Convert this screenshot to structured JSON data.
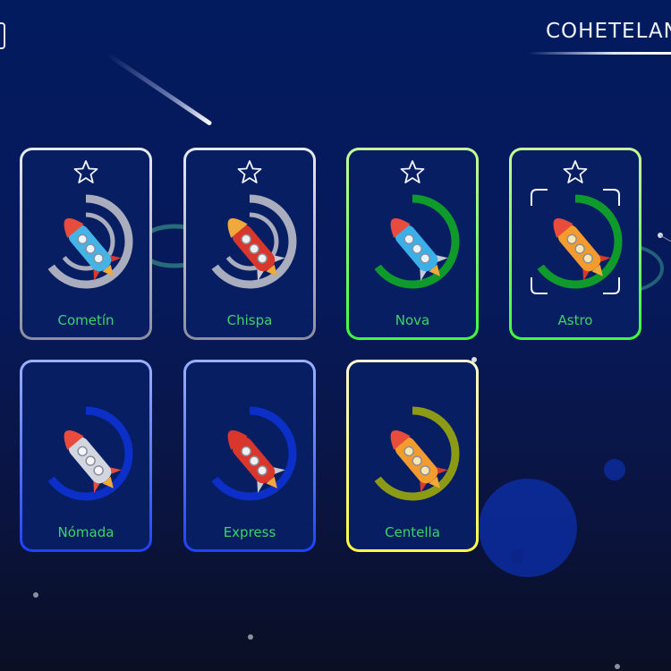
{
  "app": {
    "title": "COHETELAN"
  },
  "rockets": [
    {
      "name": "Cometín",
      "starred": true,
      "frame": "silver",
      "ring": "gray",
      "ring_progress": 0.65,
      "rocket_style": "round-blue",
      "selected": false
    },
    {
      "name": "Chispa",
      "starred": true,
      "frame": "silver",
      "ring": "gray",
      "ring_progress": 0.65,
      "rocket_style": "red-portholes",
      "selected": false
    },
    {
      "name": "Nova",
      "starred": true,
      "frame": "green",
      "ring": "green",
      "ring_progress": 0.65,
      "rocket_style": "blue-slim",
      "selected": false
    },
    {
      "name": "Astro",
      "starred": true,
      "frame": "green",
      "ring": "green",
      "ring_progress": 0.65,
      "rocket_style": "orange-portholes",
      "selected": true
    },
    {
      "name": "Nómada",
      "starred": false,
      "frame": "blue",
      "ring": "blue",
      "ring_progress": 0.65,
      "rocket_style": "silver-portholes",
      "selected": false
    },
    {
      "name": "Express",
      "starred": false,
      "frame": "blue",
      "ring": "blue",
      "ring_progress": 0.65,
      "rocket_style": "red-classic",
      "selected": false
    },
    {
      "name": "Centella",
      "starred": false,
      "frame": "yellow",
      "ring": "olive",
      "ring_progress": 0.65,
      "rocket_style": "orange-red",
      "selected": false
    }
  ],
  "colors": {
    "label": "#3ad46a",
    "card_bg": "#081e63",
    "frame_silver": [
      "#e8eaf0",
      "#8a8f9c"
    ],
    "frame_green": [
      "#c8ff9a",
      "#3cff3c"
    ],
    "frame_blue": [
      "#9bb2ff",
      "#2040ff"
    ],
    "frame_yellow": [
      "#fffbd0",
      "#ffff40"
    ],
    "ring_gray": "#a9adbd",
    "ring_green": "#0f9a2c",
    "ring_blue": "#0b2fc7",
    "ring_olive": "#8d9a16"
  }
}
